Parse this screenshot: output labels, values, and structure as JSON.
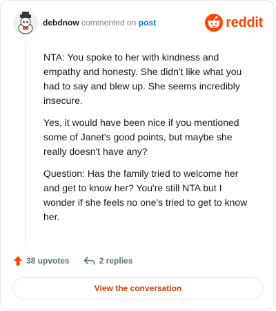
{
  "comment": {
    "username": "debdnow",
    "action_text": "commented on",
    "target_text": "post",
    "paragraphs": [
      "NTA: You spoke to her with kindness and empathy and honesty. She didn't like what you had to say and blew up. She seems incredibly insecure.",
      "Yes, it would have been nice if you mentioned some of Janet's good points, but maybe she really doesn't have any?",
      "Question: Has the family tried to welcome her and get to know her? You're still NTA but I wonder if she feels no one's tried to get to know her."
    ]
  },
  "brand": {
    "name": "reddit",
    "color": "#ff4500"
  },
  "stats": {
    "upvotes": "38 upvotes",
    "replies": "2 replies"
  },
  "cta": {
    "label": "View the conversation"
  },
  "icons": {
    "upvote": "upvote-arrow-icon",
    "reply": "reply-arrow-icon",
    "logo": "reddit-snoo-icon",
    "avatar": "user-avatar"
  }
}
